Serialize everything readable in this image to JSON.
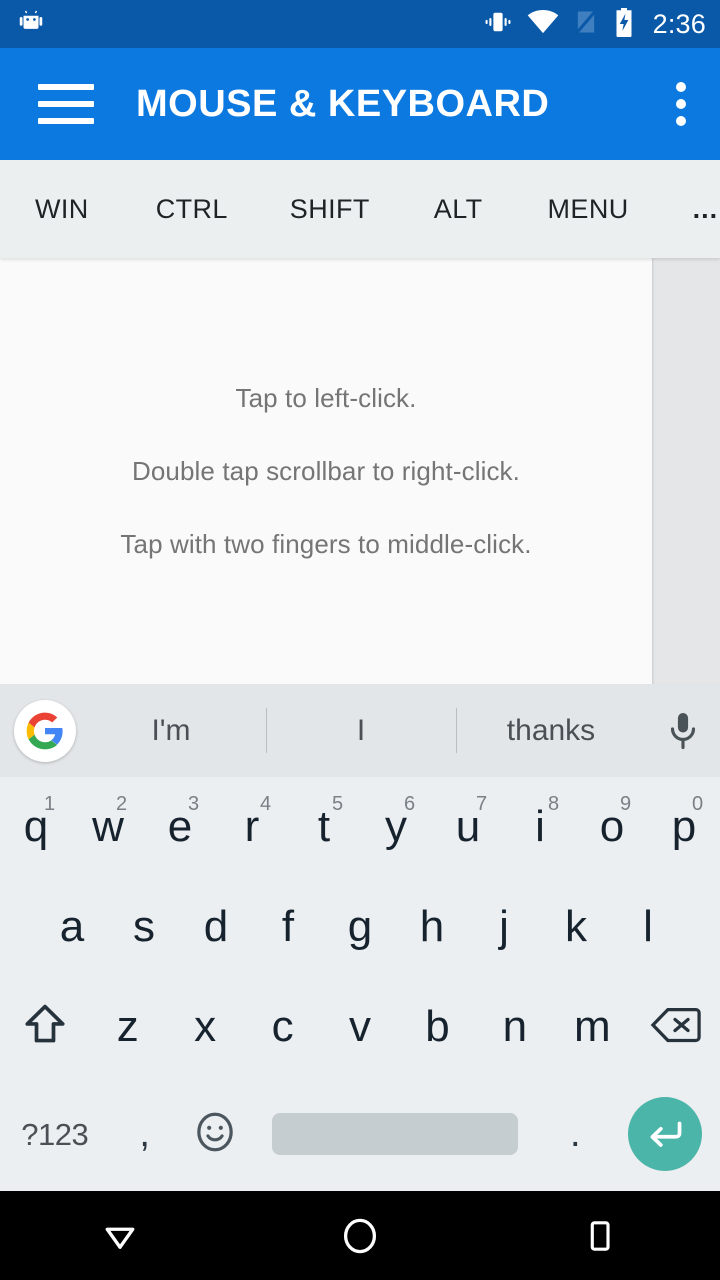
{
  "status_bar": {
    "notification_icon": "android-robot-icon",
    "icons": [
      "vibrate-icon",
      "wifi-icon",
      "no-sim-signal-icon",
      "battery-charging-icon"
    ],
    "time": "2:36",
    "background_color": "#0a59a8"
  },
  "app_bar": {
    "menu_icon": "hamburger-menu-icon",
    "title": "MOUSE & KEYBOARD",
    "overflow_icon": "overflow-menu-icon",
    "background_color": "#0b79e0"
  },
  "modifier_bar": {
    "keys": [
      "WIN",
      "CTRL",
      "SHIFT",
      "ALT",
      "MENU"
    ],
    "overflow_label": "...",
    "background_color": "#eceff0"
  },
  "touchpad": {
    "hints": [
      "Tap to left-click.",
      "Double tap scrollbar to right-click.",
      "Tap with two fingers to middle-click."
    ],
    "scrollbar_name": "scrollbar-strip",
    "background_color": "#fafafa",
    "scrollbar_color": "#e5e6e7"
  },
  "suggestion_bar": {
    "logo": "google-g-logo",
    "suggestions": [
      "I'm",
      "I",
      "thanks"
    ],
    "mic_icon": "microphone-icon",
    "background_color": "#e3e6e8"
  },
  "keyboard": {
    "background_color": "#eceff1",
    "row1": [
      {
        "label": "q",
        "num": "1"
      },
      {
        "label": "w",
        "num": "2"
      },
      {
        "label": "e",
        "num": "3"
      },
      {
        "label": "r",
        "num": "4"
      },
      {
        "label": "t",
        "num": "5"
      },
      {
        "label": "y",
        "num": "6"
      },
      {
        "label": "u",
        "num": "7"
      },
      {
        "label": "i",
        "num": "8"
      },
      {
        "label": "o",
        "num": "9"
      },
      {
        "label": "p",
        "num": "0"
      }
    ],
    "row2": [
      {
        "label": "a"
      },
      {
        "label": "s"
      },
      {
        "label": "d"
      },
      {
        "label": "f"
      },
      {
        "label": "g"
      },
      {
        "label": "h"
      },
      {
        "label": "j"
      },
      {
        "label": "k"
      },
      {
        "label": "l"
      }
    ],
    "row3": [
      {
        "label": "z"
      },
      {
        "label": "x"
      },
      {
        "label": "c"
      },
      {
        "label": "v"
      },
      {
        "label": "b"
      },
      {
        "label": "n"
      },
      {
        "label": "m"
      }
    ],
    "shift_icon": "shift-arrow-icon",
    "backspace_icon": "backspace-icon",
    "symbols_label": "?123",
    "comma_label": ",",
    "emoji_icon": "emoji-smiley-icon",
    "space_label": "",
    "period_label": ".",
    "enter_icon": "enter-return-icon",
    "enter_color": "#4cb5aa",
    "spacebar_color": "#c6cdd1"
  },
  "nav_bar": {
    "back_icon": "keyboard-dismiss-down-icon",
    "home_icon": "home-circle-icon",
    "recents_icon": "recents-square-icon",
    "background_color": "#000000"
  }
}
